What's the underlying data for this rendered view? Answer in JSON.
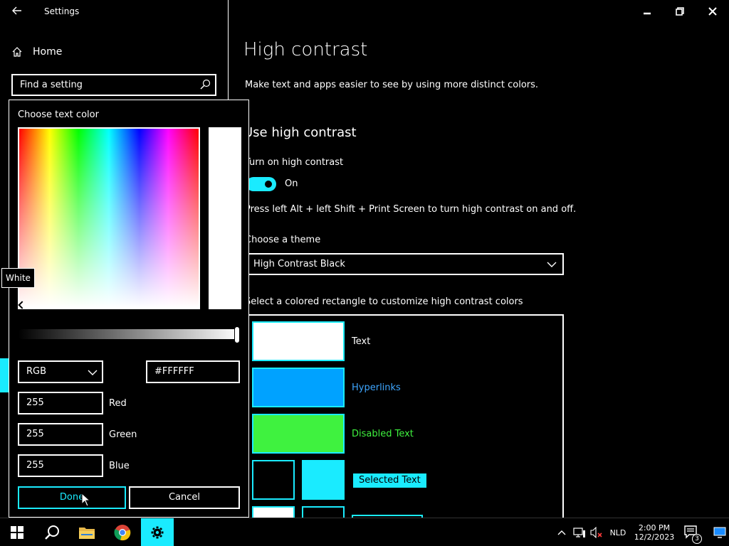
{
  "window": {
    "title": "Settings"
  },
  "sidebar": {
    "home_label": "Home",
    "search_placeholder": "Find a setting"
  },
  "main": {
    "title": "High contrast",
    "description": "Make text and apps easier to see by using more distinct colors.",
    "section_title": "Use high contrast",
    "toggle_label": "Turn on high contrast",
    "toggle_state": "On",
    "shortcut_text": "Press left Alt + left Shift + Print Screen to turn high contrast on and off.",
    "theme_label": "Choose a theme",
    "theme_value": "High Contrast Black",
    "customize_label": "Select a colored rectangle to customize high contrast colors",
    "swatches": {
      "text": {
        "label": "Text",
        "color": "#ffffff"
      },
      "hyperlinks": {
        "label": "Hyperlinks",
        "color": "#00a2ff"
      },
      "disabled": {
        "label": "Disabled Text",
        "color": "#3ff23f"
      },
      "selected": {
        "label": "Selected Text",
        "color": "#1aebff"
      }
    }
  },
  "picker": {
    "title": "Choose text color",
    "mode": "RGB",
    "hex": "#FFFFFF",
    "red_value": "255",
    "red_label": "Red",
    "green_value": "255",
    "green_label": "Green",
    "blue_value": "255",
    "blue_label": "Blue",
    "done_label": "Done",
    "cancel_label": "Cancel",
    "tooltip": "White"
  },
  "taskbar": {
    "language": "NLD",
    "time": "2:00 PM",
    "date": "12/2/2023",
    "notification_count": "3"
  },
  "colors": {
    "accent": "#1aebff",
    "background": "#000000",
    "foreground": "#ffffff"
  }
}
